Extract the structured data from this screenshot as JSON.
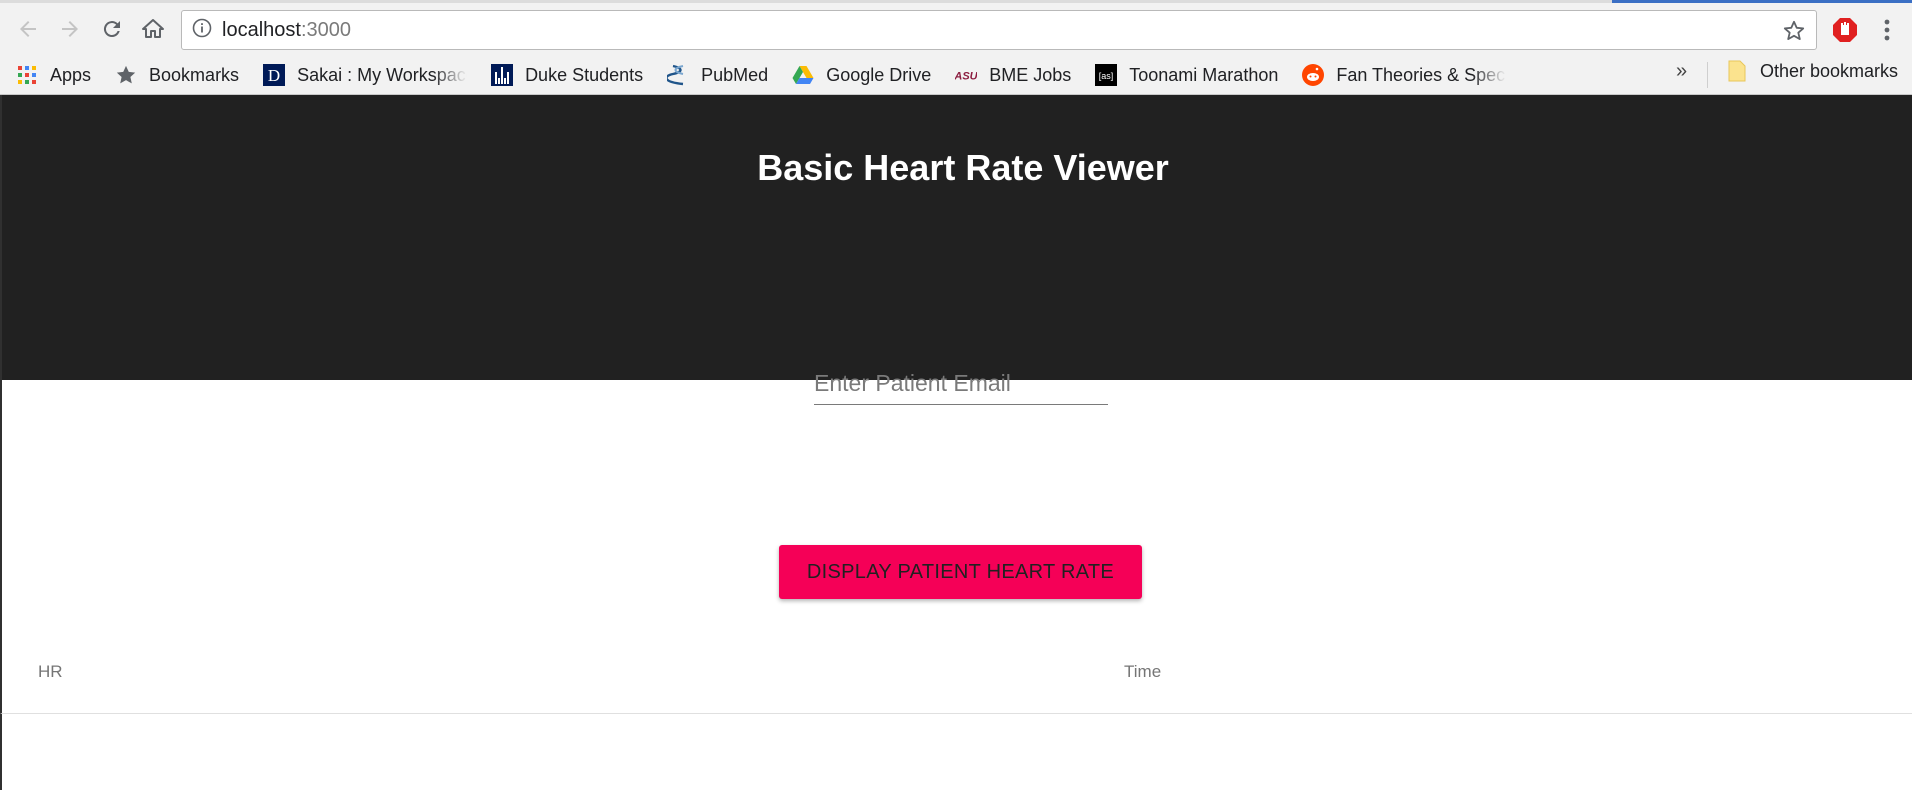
{
  "browser": {
    "url_host": "localhost",
    "url_port": ":3000",
    "bookmarks": [
      {
        "label": "Apps",
        "icon": "apps-grid-icon"
      },
      {
        "label": "Bookmarks",
        "icon": "star-icon"
      },
      {
        "label": "Sakai : My Workspace",
        "icon": "duke-d-icon"
      },
      {
        "label": "Duke Students",
        "icon": "duke-chapel-icon"
      },
      {
        "label": "PubMed",
        "icon": "pubmed-icon"
      },
      {
        "label": "Google Drive",
        "icon": "google-drive-icon"
      },
      {
        "label": "BME Jobs",
        "icon": "asu-icon"
      },
      {
        "label": "Toonami Marathon",
        "icon": "adult-swim-icon"
      },
      {
        "label": "Fan Theories & Specu",
        "icon": "reddit-icon"
      }
    ],
    "overflow_label": "»",
    "other_bookmarks": "Other bookmarks"
  },
  "app": {
    "title": "Basic Heart Rate Viewer",
    "email_placeholder": "Enter Patient Email",
    "email_value": "",
    "display_button": "DISPLAY PATIENT HEART RATE",
    "table": {
      "columns": [
        "HR",
        "Time"
      ],
      "rows": []
    }
  },
  "colors": {
    "appbar": "#212121",
    "accent_button": "#f50057"
  }
}
